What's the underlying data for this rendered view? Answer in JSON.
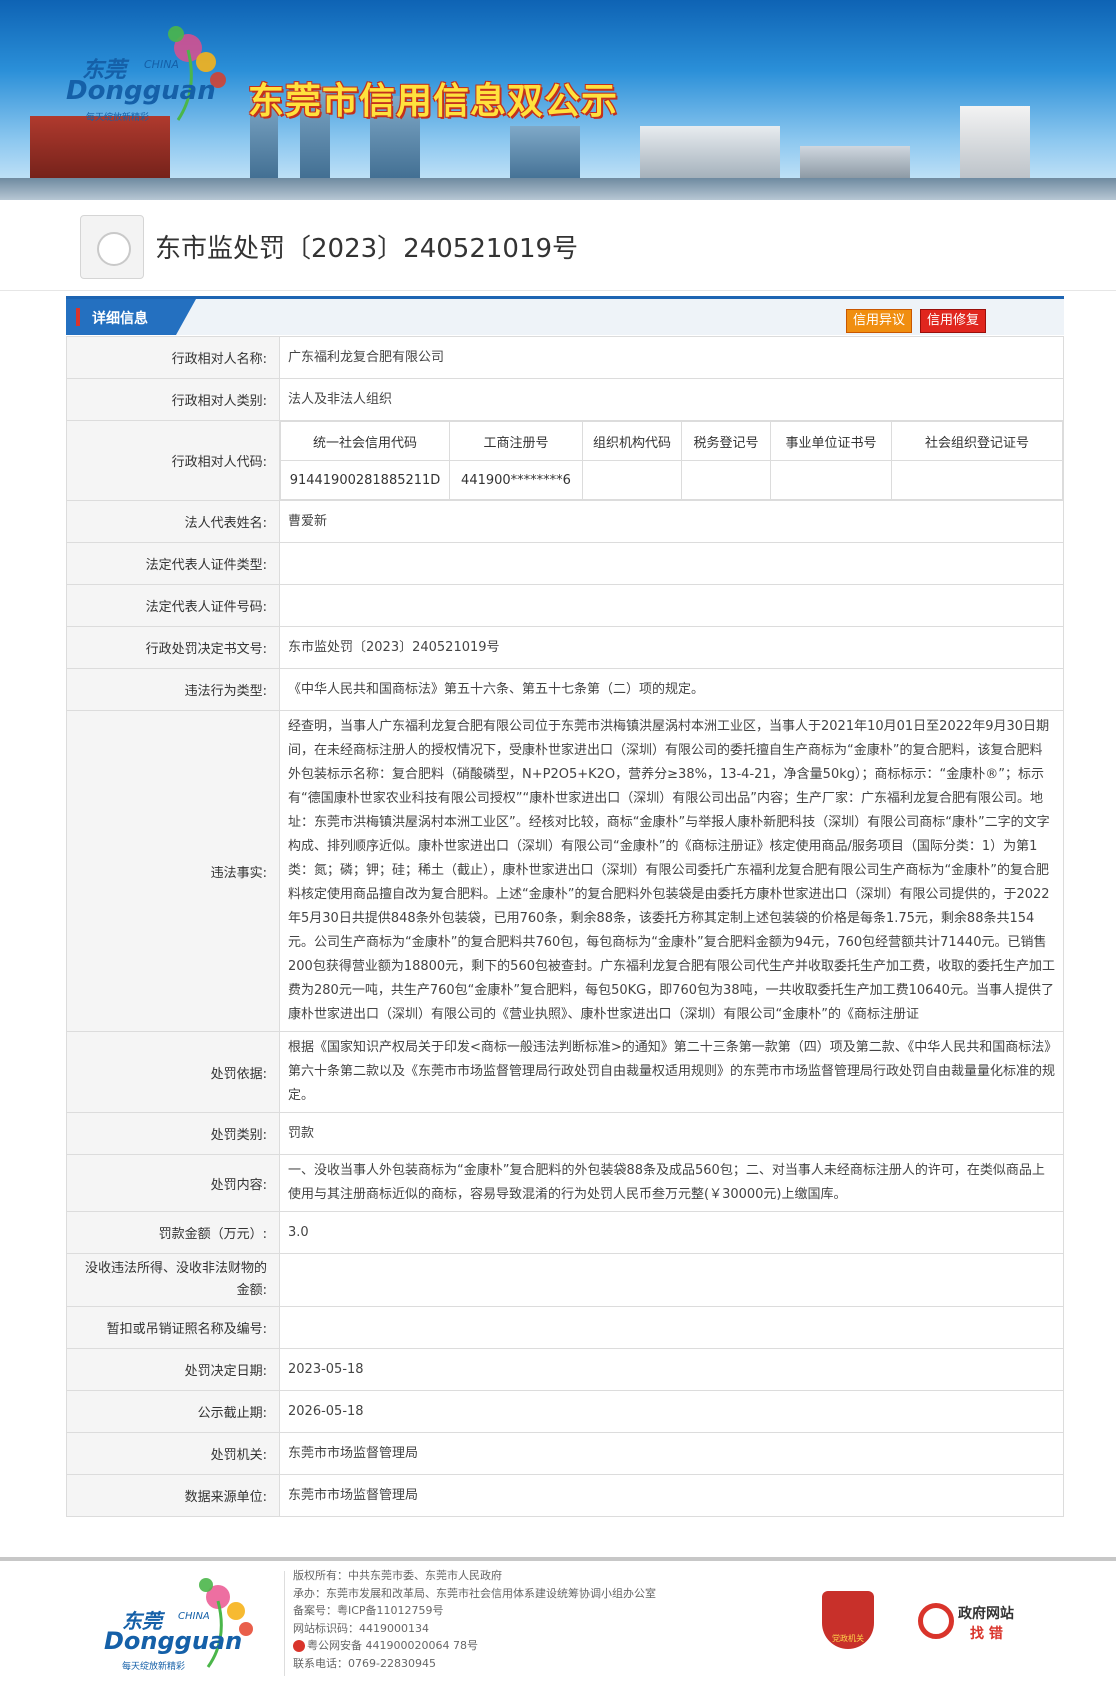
{
  "banner": {
    "logo_cn": "东莞",
    "logo_china": "CHINA",
    "logo_en": "Dongguan",
    "logo_tagline": "每天绽放新精彩",
    "title": "东莞市信用信息双公示"
  },
  "page_title": "东市监处罚〔2023〕240521019号",
  "section": {
    "title": "详细信息",
    "btn_objection": "信用异议",
    "btn_repair": "信用修复"
  },
  "rows": {
    "party_name": {
      "label": "行政相对人名称:",
      "value": "广东福利龙复合肥有限公司"
    },
    "party_type": {
      "label": "行政相对人类别:",
      "value": "法人及非法人组织"
    },
    "party_code": {
      "label": "行政相对人代码:",
      "headers": [
        "统一社会信用代码",
        "工商注册号",
        "组织机构代码",
        "税务登记号",
        "事业单位证书号",
        "社会组织登记证号"
      ],
      "values": [
        "91441900281885211D",
        "441900********6",
        "",
        "",
        "",
        ""
      ]
    },
    "legal_rep": {
      "label": "法人代表姓名:",
      "value": "曹爱新"
    },
    "legal_id_type": {
      "label": "法定代表人证件类型:",
      "value": ""
    },
    "legal_id_no": {
      "label": "法定代表人证件号码:",
      "value": ""
    },
    "decision_no": {
      "label": "行政处罚决定书文号:",
      "value": "东市监处罚〔2023〕240521019号"
    },
    "violation_type": {
      "label": "违法行为类型:",
      "value": "《中华人民共和国商标法》第五十六条、第五十七条第（二）项的规定。"
    },
    "violation_fact": {
      "label": "违法事实:",
      "value": "经查明，当事人广东福利龙复合肥有限公司位于东莞市洪梅镇洪屋涡村本洲工业区，当事人于2021年10月01日至2022年9月30日期间，在未经商标注册人的授权情况下，受康朴世家进出口（深圳）有限公司的委托擅自生产商标为“金康朴”的复合肥料，该复合肥料外包装标示名称：复合肥料（硝酸磷型，N+P2O5+K2O，营养分≥38%，13-4-21，净含量50kg）；商标标示：“金康朴®”；标示有“德国康朴世家农业科技有限公司授权”“康朴世家进出口（深圳）有限公司出品”内容；生产厂家：广东福利龙复合肥有限公司。地址：东莞市洪梅镇洪屋涡村本洲工业区”。经核对比较，商标“金康朴”与举报人康朴新肥科技（深圳）有限公司商标“康朴”二字的文字构成、排列顺序近似。康朴世家进出口（深圳）有限公司“金康朴”的《商标注册证》核定使用商品/服务项目（国际分类：1）为第1类：氮；磷；钾；硅；稀土（截止），康朴世家进出口（深圳）有限公司委托广东福利龙复合肥有限公司生产商标为“金康朴”的复合肥料核定使用商品擅自改为复合肥料。上述“金康朴”的复合肥料外包装袋是由委托方康朴世家进出口（深圳）有限公司提供的，于2022年5月30日共提供848条外包装袋，已用760条，剩余88条，该委托方称其定制上述包装袋的价格是每条1.75元，剩余88条共154元。公司生产商标为“金康朴”的复合肥料共760包，每包商标为“金康朴”复合肥料金额为94元，760包经营额共计71440元。已销售200包获得营业额为18800元，剩下的560包被查封。广东福利龙复合肥有限公司代生产并收取委托生产加工费，收取的委托生产加工费为280元一吨，共生产760包“金康朴”复合肥料，每包50KG，即760包为38吨，一共收取委托生产加工费10640元。当事人提供了康朴世家进出口（深圳）有限公司的《营业执照》、康朴世家进出口（深圳）有限公司“金康朴”的《商标注册证"
    },
    "penalty_basis": {
      "label": "处罚依据:",
      "value": "根据《国家知识产权局关于印发<商标一般违法判断标准>的通知》第二十三条第一款第（四）项及第二款、《中华人民共和国商标法》第六十条第二款以及《东莞市市场监督管理局行政处罚自由裁量权适用规则》的东莞市市场监督管理局行政处罚自由裁量量化标准的规定。"
    },
    "penalty_category": {
      "label": "处罚类别:",
      "value": "罚款"
    },
    "penalty_content": {
      "label": "处罚内容:",
      "value": "一、没收当事人外包装商标为“金康朴”复合肥料的外包装袋88条及成品560包；二、对当事人未经商标注册人的许可，在类似商品上使用与其注册商标近似的商标，容易导致混淆的行为处罚人民币叁万元整(￥30000元)上缴国库。"
    },
    "fine_amount": {
      "label": "罚款金额（万元）:",
      "value": "3.0"
    },
    "confiscated": {
      "label": "没收违法所得、没收非法财物的金额:",
      "value": ""
    },
    "license_revoked": {
      "label": "暂扣或吊销证照名称及编号:",
      "value": ""
    },
    "decision_date": {
      "label": "处罚决定日期:",
      "value": "2023-05-18"
    },
    "publicity_end": {
      "label": "公示截止期:",
      "value": "2026-05-18"
    },
    "authority": {
      "label": "处罚机关:",
      "value": "东莞市市场监督管理局"
    },
    "data_source": {
      "label": "数据来源单位:",
      "value": "东莞市市场监督管理局"
    }
  },
  "footer": {
    "copyright": "版权所有：中共东莞市委、东莞市人民政府",
    "host": "承办：东莞市发展和改革局、东莞市社会信用体系建设统筹协调小组办公室",
    "icp": "备案号：粤ICP备11012759号",
    "site_id": "网站标识码：4419000134",
    "police": "粤公网安备 441900020064 78号",
    "phone": "联系电话：0769-22830945",
    "gov_badge": "党政机关",
    "find_error_1": "政府网站",
    "find_error_2": "找 错"
  }
}
